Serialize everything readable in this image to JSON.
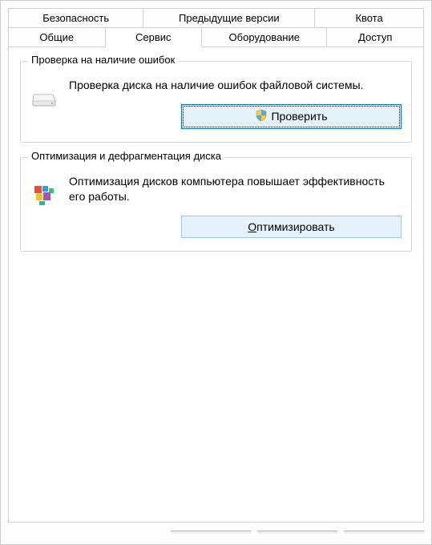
{
  "tabs": {
    "row1": [
      {
        "label": "Безопасность"
      },
      {
        "label": "Предыдущие версии"
      },
      {
        "label": "Квота"
      }
    ],
    "row2": [
      {
        "label": "Общие"
      },
      {
        "label": "Сервис"
      },
      {
        "label": "Оборудование"
      },
      {
        "label": "Доступ"
      }
    ]
  },
  "check": {
    "legend": "Проверка на наличие ошибок",
    "description": "Проверка диска на наличие ошибок файловой системы.",
    "button": "Проверить"
  },
  "optimize": {
    "legend": "Оптимизация и дефрагментация диска",
    "description": "Оптимизация дисков компьютера повышает эффективность его работы.",
    "button": "Оптимизировать"
  }
}
